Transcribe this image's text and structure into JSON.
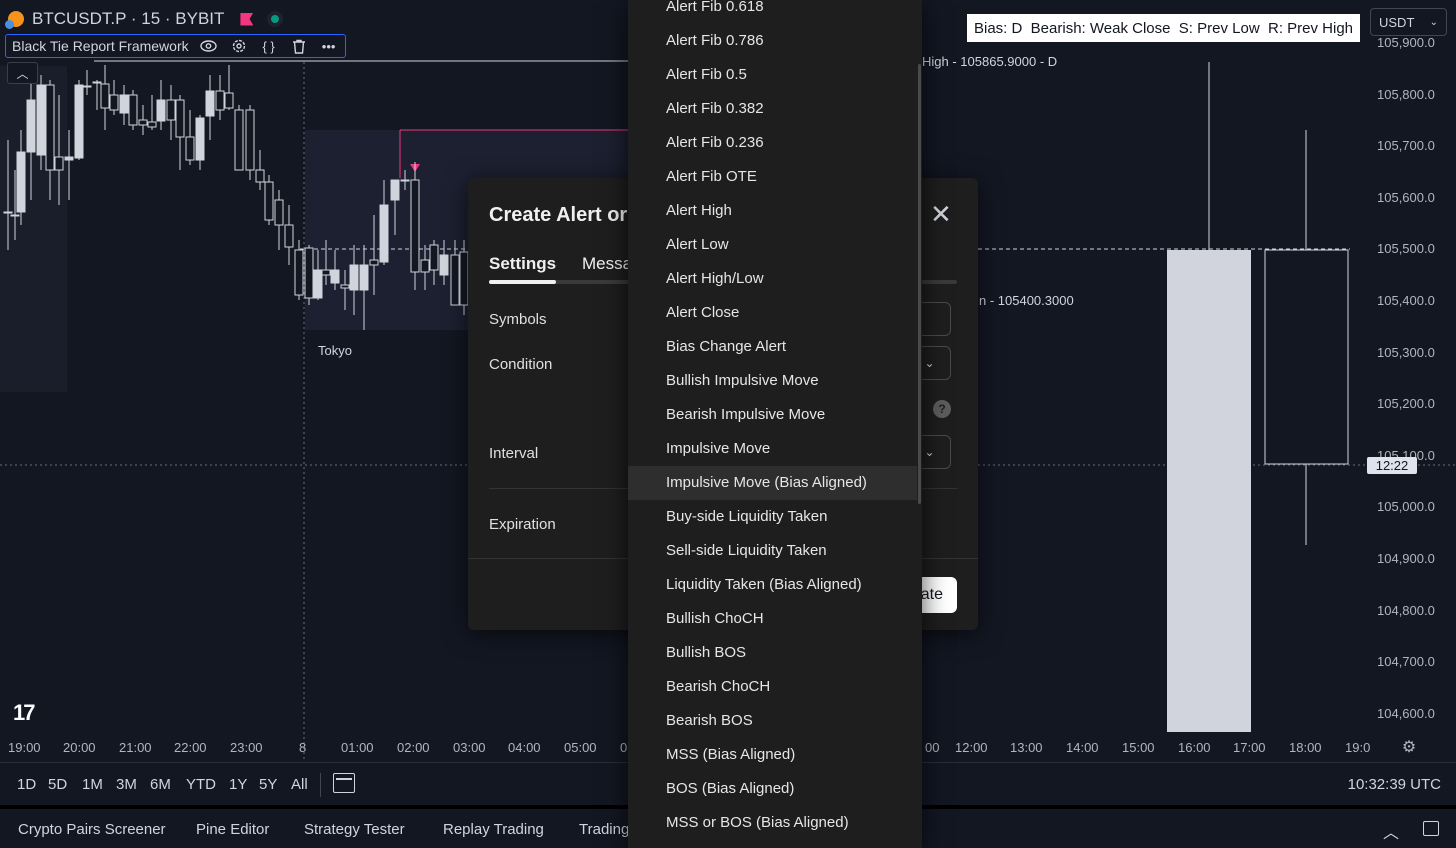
{
  "header": {
    "symbol": "BTCUSDT.P · 15 · BYBIT",
    "indicator_name": "Black Tie Report Framework",
    "bias_legend": "Bias: D  Bearish: Weak Close  S: Prev Low  R: Prev High",
    "currency": "USDT"
  },
  "chart_labels": {
    "session_label": "Tokyo",
    "high_label": "High - 105865.9000 - D",
    "mid_label": "n - 105400.3000",
    "clock_tag": "12:22"
  },
  "price_axis": [
    "105,900.0",
    "105,800.0",
    "105,700.0",
    "105,600.0",
    "105,500.0",
    "105,400.0",
    "105,300.0",
    "105,200.0",
    "105,100.0",
    "105,000.0",
    "104,900.0",
    "104,800.0",
    "104,700.0",
    "104,600.0"
  ],
  "time_axis": [
    "19:00",
    "20:00",
    "21:00",
    "22:00",
    "23:00",
    "8",
    "01:00",
    "02:00",
    "03:00",
    "04:00",
    "05:00",
    "0",
    "00",
    "12:00",
    "13:00",
    "14:00",
    "15:00",
    "16:00",
    "17:00",
    "18:00",
    "19:0"
  ],
  "range_bar": {
    "ranges": [
      "1D",
      "5D",
      "1M",
      "3M",
      "6M",
      "YTD",
      "1Y",
      "5Y",
      "All"
    ],
    "clock": "10:32:39 UTC"
  },
  "bottom_panel": {
    "tabs": [
      "Crypto Pairs Screener",
      "Pine Editor",
      "Strategy Tester",
      "Replay Trading",
      "Trading"
    ]
  },
  "dialog": {
    "title": "Create Alert or",
    "tabs": [
      "Settings",
      "Messa"
    ],
    "labels": {
      "symbols": "Symbols",
      "condition": "Condition",
      "interval": "Interval",
      "expiration": "Expiration"
    },
    "help": "?",
    "create_button": "ate"
  },
  "menu": {
    "highlighted": "Impulsive Move (Bias Aligned)",
    "items": [
      "Alert Fib 0.618",
      "Alert Fib 0.786",
      "Alert Fib 0.5",
      "Alert Fib 0.382",
      "Alert Fib 0.236",
      "Alert Fib OTE",
      "Alert High",
      "Alert Low",
      "Alert High/Low",
      "Alert Close",
      "Bias Change Alert",
      "Bullish Impulsive Move",
      "Bearish Impulsive Move",
      "Impulsive Move",
      "Impulsive Move (Bias Aligned)",
      "Buy-side Liquidity Taken",
      "Sell-side Liquidity Taken",
      "Liquidity Taken (Bias Aligned)",
      "Bullish ChoCH",
      "Bullish BOS",
      "Bearish ChoCH",
      "Bearish BOS",
      "MSS (Bias Aligned)",
      "BOS (Bias Aligned)",
      "MSS or BOS (Bias Aligned)"
    ]
  },
  "colors": {
    "chart_bg": "#131722",
    "candle_up": "#d1d4dc",
    "accent_blue": "#2962ff",
    "marker_pink": "#f23680",
    "menu_bg": "#1e1e1e"
  }
}
